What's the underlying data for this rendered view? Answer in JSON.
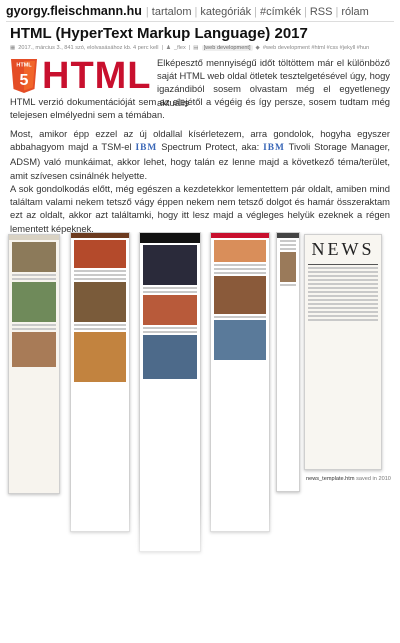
{
  "site": {
    "brand": "gyorgy.fleischmann.hu"
  },
  "nav": [
    "tartalom",
    "kategóriák",
    "#címkék",
    "RSS",
    "rólam"
  ],
  "post": {
    "title": "HTML (HyperText Markup Language) 2017",
    "meta": {
      "date": "2017., március 3., 841 szó, elolvasásához kb. 4 perc kell",
      "author": "_flex",
      "category": "[web development]",
      "tags": "#web development #html #css #jekyll #hun"
    },
    "logo_text": "HTML",
    "paragraph1_a": "Elképesztő mennyiségű időt töltöttem már el különböző saját HTML web oldal ötletek tesztelgetésével úgy, hogy igazándiból sosem olvastam még el egyetlenegy aktuális",
    "paragraph1_b": "HTML verzió dokumentációját sem az elejétől a végéig és így persze, sosem tudtam még telejesen elmélyedni sem a témában.",
    "paragraph2_a": "Most, amikor épp ezzel az új oldallal kísérletezem, arra gondolok, hogyha egyszer abbahagyom majd a TSM-el",
    "paragraph2_ibm": "IBM",
    "paragraph2_b": "Spectrum Protect, aka:",
    "paragraph2_ibm2": "IBM",
    "paragraph2_c": "Tivoli Storage Manager, ADSM) való munkáimat, akkor lehet, hogy talán ez lenne majd a következő téma/terület, amit szívesen csinálnék helyette.",
    "paragraph3": "A sok gondolkodás előtt, még egészen a kezdetekkor lementettem pár oldalt, amiben mind találtam valami nekem tetsző vágy éppen nekem nem tetsző dolgot és hamár összeraktam ezt az oldalt, akkor azt találtamki, hogy itt lesz majd a végleges helyük ezeknek a régen lementett képeknek.",
    "gallery": {
      "news_title": "NEWS",
      "caption_file": "news_template.htm",
      "caption_rest": "saved in 2010"
    }
  },
  "colors": {
    "html_red": "#c8102e",
    "ibm_blue": "#3a67b7",
    "shield_orange": "#e44d26"
  }
}
